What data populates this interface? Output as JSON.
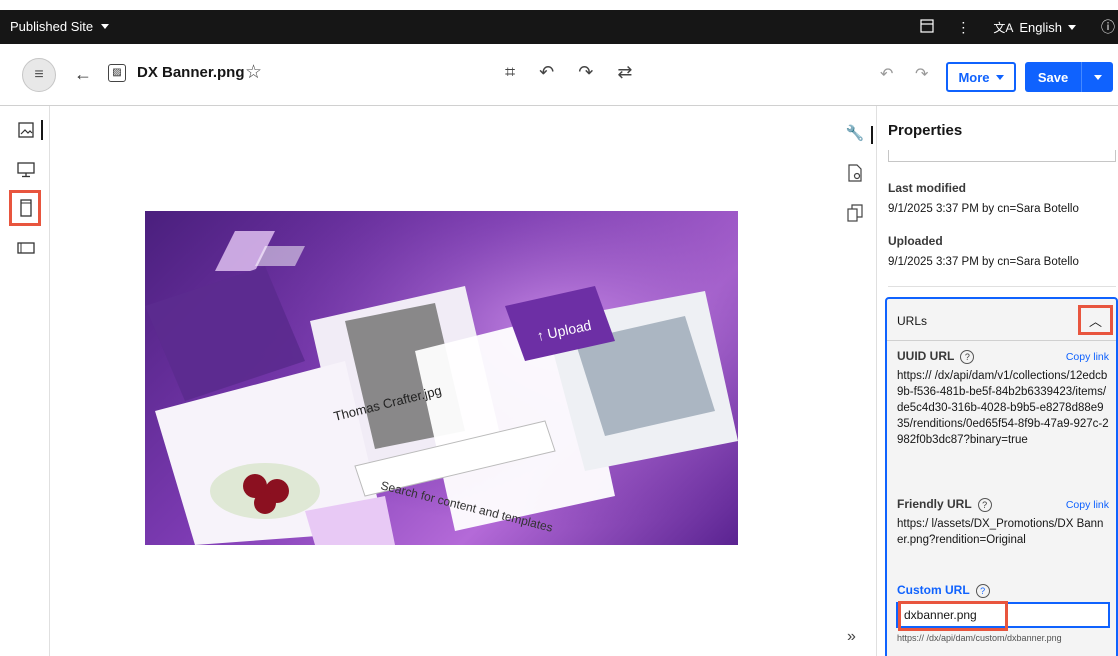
{
  "topbar": {
    "site_label": "Published Site",
    "language": "English"
  },
  "toolbar": {
    "file_name": "DX Banner.png",
    "more_label": "More",
    "save_label": "Save"
  },
  "properties": {
    "title": "Properties",
    "last_modified_label": "Last modified",
    "last_modified_value": "9/1/2025 3:37 PM by cn=Sara Botello",
    "uploaded_label": "Uploaded",
    "uploaded_value": "9/1/2025 3:37 PM by cn=Sara Botello",
    "urls": {
      "title": "URLs",
      "uuid_label": "UUID URL",
      "uuid_copy": "Copy link",
      "uuid_value": "https://                    /dx/api/dam/v1/collections/12edcb9b-f536-481b-be5f-84b2b6339423/items/de5c4d30-316b-4028-b9b5-e8278d88e935/renditions/0ed65f54-8f9b-47a9-927c-2982f0b3dc87?binary=true",
      "friendly_label": "Friendly URL",
      "friendly_copy": "Copy link",
      "friendly_value": "https:/                    l/assets/DX_Promotions/DX Banner.png?rendition=Original",
      "custom_label": "Custom URL",
      "custom_value": "dxbanner.png",
      "custom_preview": "https://                         /dx/api/dam/custom/dxbanner.png"
    }
  },
  "colors": {
    "accent": "#0f62fe",
    "highlight": "#e8553e",
    "topbar_bg": "#161616"
  }
}
